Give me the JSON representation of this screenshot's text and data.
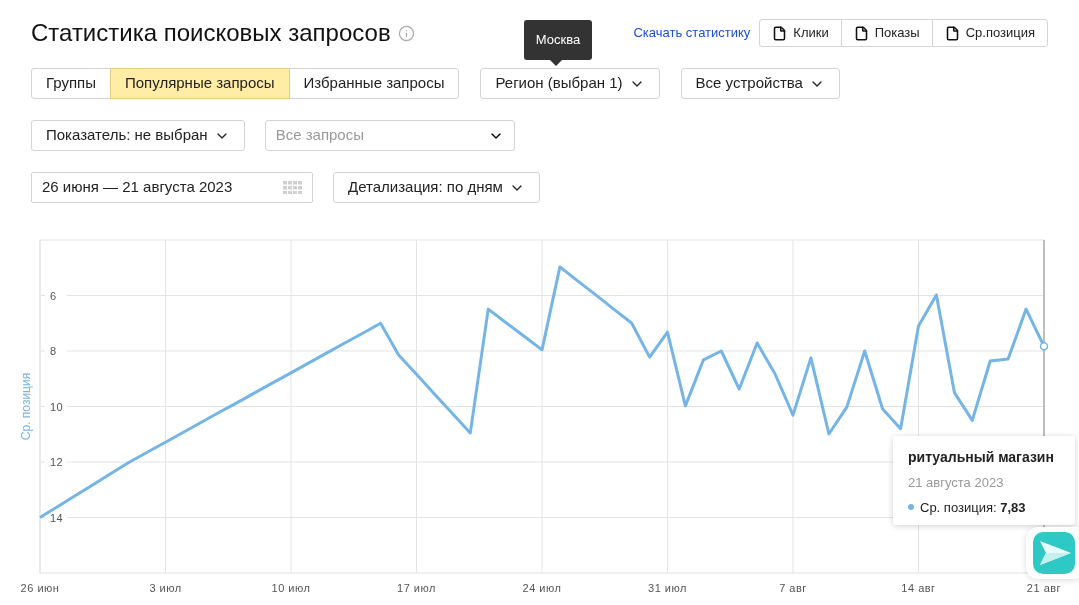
{
  "title": "Статистика поисковых запросов",
  "region_tooltip": "Москва",
  "download_link": "Скачать статистику",
  "download_buttons": [
    "Клики",
    "Показы",
    "Ср.позиция"
  ],
  "view_tabs": [
    {
      "label": "Группы",
      "selected": false
    },
    {
      "label": "Популярные запросы",
      "selected": true
    },
    {
      "label": "Избранные запросы",
      "selected": false
    }
  ],
  "region_button": "Регион (выбран 1)",
  "devices_button": "Все устройства",
  "metric_button": "Показатель: не выбран",
  "query_select": {
    "placeholder": "Все запросы"
  },
  "date_field": {
    "value": "26 июня — 21 августа 2023"
  },
  "detail_button": "Детализация: по дням",
  "chart": {
    "chart_data": {
      "type": "line",
      "ylabel": "Ср. позиция",
      "categories": [
        "26 июн",
        null,
        null,
        null,
        null,
        null,
        null,
        "3 июл",
        null,
        null,
        null,
        null,
        null,
        null,
        "10 июл",
        null,
        null,
        null,
        null,
        null,
        null,
        "17 июл",
        null,
        null,
        null,
        null,
        null,
        null,
        "24 июл",
        null,
        null,
        null,
        null,
        null,
        null,
        "31 июл",
        null,
        null,
        null,
        null,
        null,
        null,
        "7 авг",
        null,
        null,
        null,
        null,
        null,
        null,
        "14 авг",
        null,
        null,
        null,
        null,
        null,
        null,
        "21 авг"
      ],
      "series": [
        {
          "color": "#74b5e6",
          "values": [
            14,
            13.6,
            13.2,
            12.8,
            12.4,
            12,
            11.64,
            11.29,
            10.93,
            10.57,
            10.21,
            9.86,
            9.5,
            9.14,
            8.79,
            8.43,
            8.07,
            7.71,
            7.36,
            7,
            8.14,
            8.84,
            9.55,
            10.25,
            10.95,
            6.49,
            6.98,
            7.47,
            7.96,
            4.97,
            5.48,
            5.98,
            6.49,
            6.99,
            8.22,
            7.32,
            9.98,
            8.32,
            8,
            9.37,
            7.71,
            8.83,
            10.31,
            8.25,
            10.99,
            10.02,
            8,
            10.09,
            10.8,
            7.1,
            5.98,
            9.5,
            10.5,
            8.36,
            8.29,
            6.49,
            7.83
          ]
        }
      ],
      "ylim": [
        16,
        4
      ],
      "grid": true,
      "yticks": [
        6,
        8,
        10,
        12,
        14
      ]
    },
    "hover_tooltip": {
      "title": "ритуальный магазин",
      "date": "21 августа 2023",
      "reading": "Ср. позиция: **7,83**"
    }
  }
}
